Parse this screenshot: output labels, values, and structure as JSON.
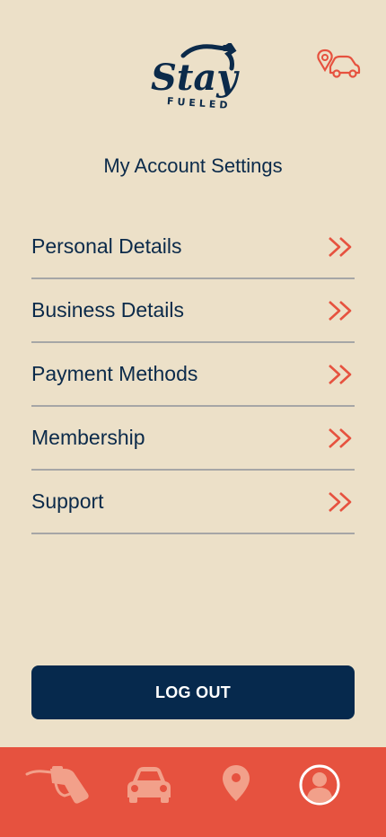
{
  "logo": {
    "word": "Stay",
    "sub": "FUELED"
  },
  "page_title": "My Account Settings",
  "menu": [
    {
      "label": "Personal Details"
    },
    {
      "label": "Business Details"
    },
    {
      "label": "Payment Methods"
    },
    {
      "label": "Membership"
    },
    {
      "label": "Support"
    }
  ],
  "logout_label": "LOG OUT",
  "bottom_nav": [
    {
      "icon": "fuel-nozzle-icon"
    },
    {
      "icon": "car-icon"
    },
    {
      "icon": "location-pin-icon"
    },
    {
      "icon": "profile-icon"
    }
  ],
  "colors": {
    "background": "#ECE0C8",
    "navy": "#0B2A4A",
    "accent": "#E6523F",
    "button": "#06294D"
  }
}
